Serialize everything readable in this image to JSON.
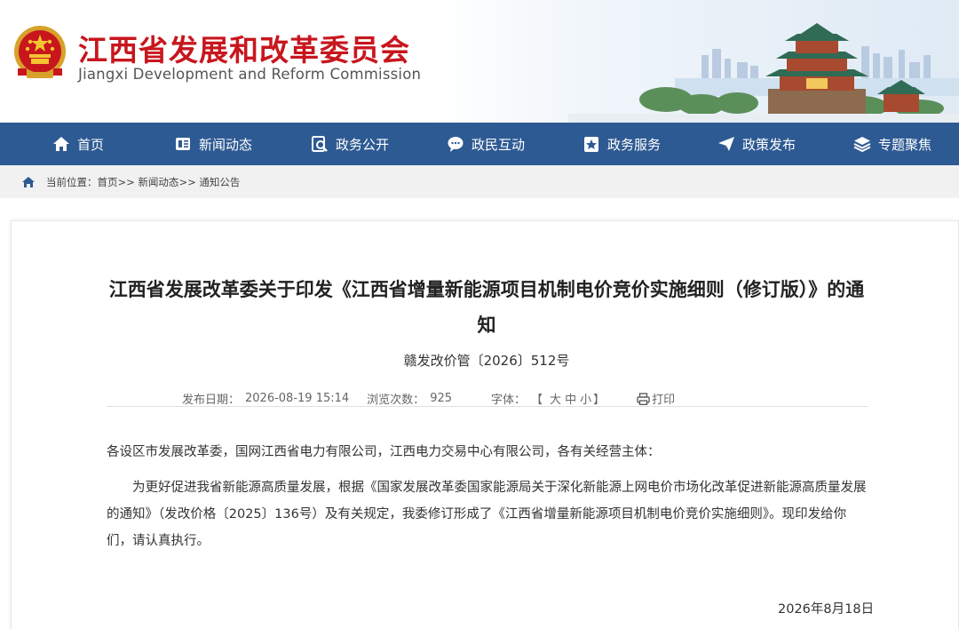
{
  "header": {
    "title": "江西省发展和改革委员会",
    "subtitle": "Jiangxi Development and Reform Commission",
    "emblem_icon": "national-emblem-icon"
  },
  "nav": {
    "items": [
      {
        "label": "首页",
        "icon": "home-icon"
      },
      {
        "label": "新闻动态",
        "icon": "news-icon"
      },
      {
        "label": "政务公开",
        "icon": "search-doc-icon"
      },
      {
        "label": "政民互动",
        "icon": "chat-icon"
      },
      {
        "label": "政务服务",
        "icon": "star-badge-icon"
      },
      {
        "label": "政策发布",
        "icon": "paper-plane-icon"
      },
      {
        "label": "专题聚焦",
        "icon": "layers-icon"
      }
    ]
  },
  "breadcrumb": {
    "prefix": "当前位置：",
    "items": [
      "首页",
      "新闻动态",
      "通知公告"
    ],
    "separator": ">>"
  },
  "article": {
    "title": "江西省发展改革委关于印发《江西省增量新能源项目机制电价竞价实施细则（修订版）》的通知",
    "doc_number": "赣发改价管〔2026〕512号",
    "meta": {
      "publish_label": "发布日期：",
      "publish_date": "2026-08-19 15:14",
      "views_label": "浏览次数：",
      "views": "925",
      "font_label": "字体：",
      "font_open": "【",
      "font_large": "大",
      "font_medium": "中",
      "font_small": "小",
      "font_close": "】",
      "print_label": "打印"
    },
    "paragraphs": [
      "各设区市发展改革委，国网江西省电力有限公司，江西电力交易中心有限公司，各有关经营主体：",
      "为更好促进我省新能源高质量发展，根据《国家发展改革委国家能源局关于深化新能源上网电价市场化改革促进新能源高质量发展的通知》（发改价格〔2025〕136号）及有关规定，我委修订形成了《江西省增量新能源项目机制电价竞价实施细则》。现印发给你们，请认真执行。"
    ],
    "signature_date": "2026年8月18日"
  },
  "colors": {
    "brand_red": "#c8161d",
    "nav_blue": "#2e5a93"
  }
}
